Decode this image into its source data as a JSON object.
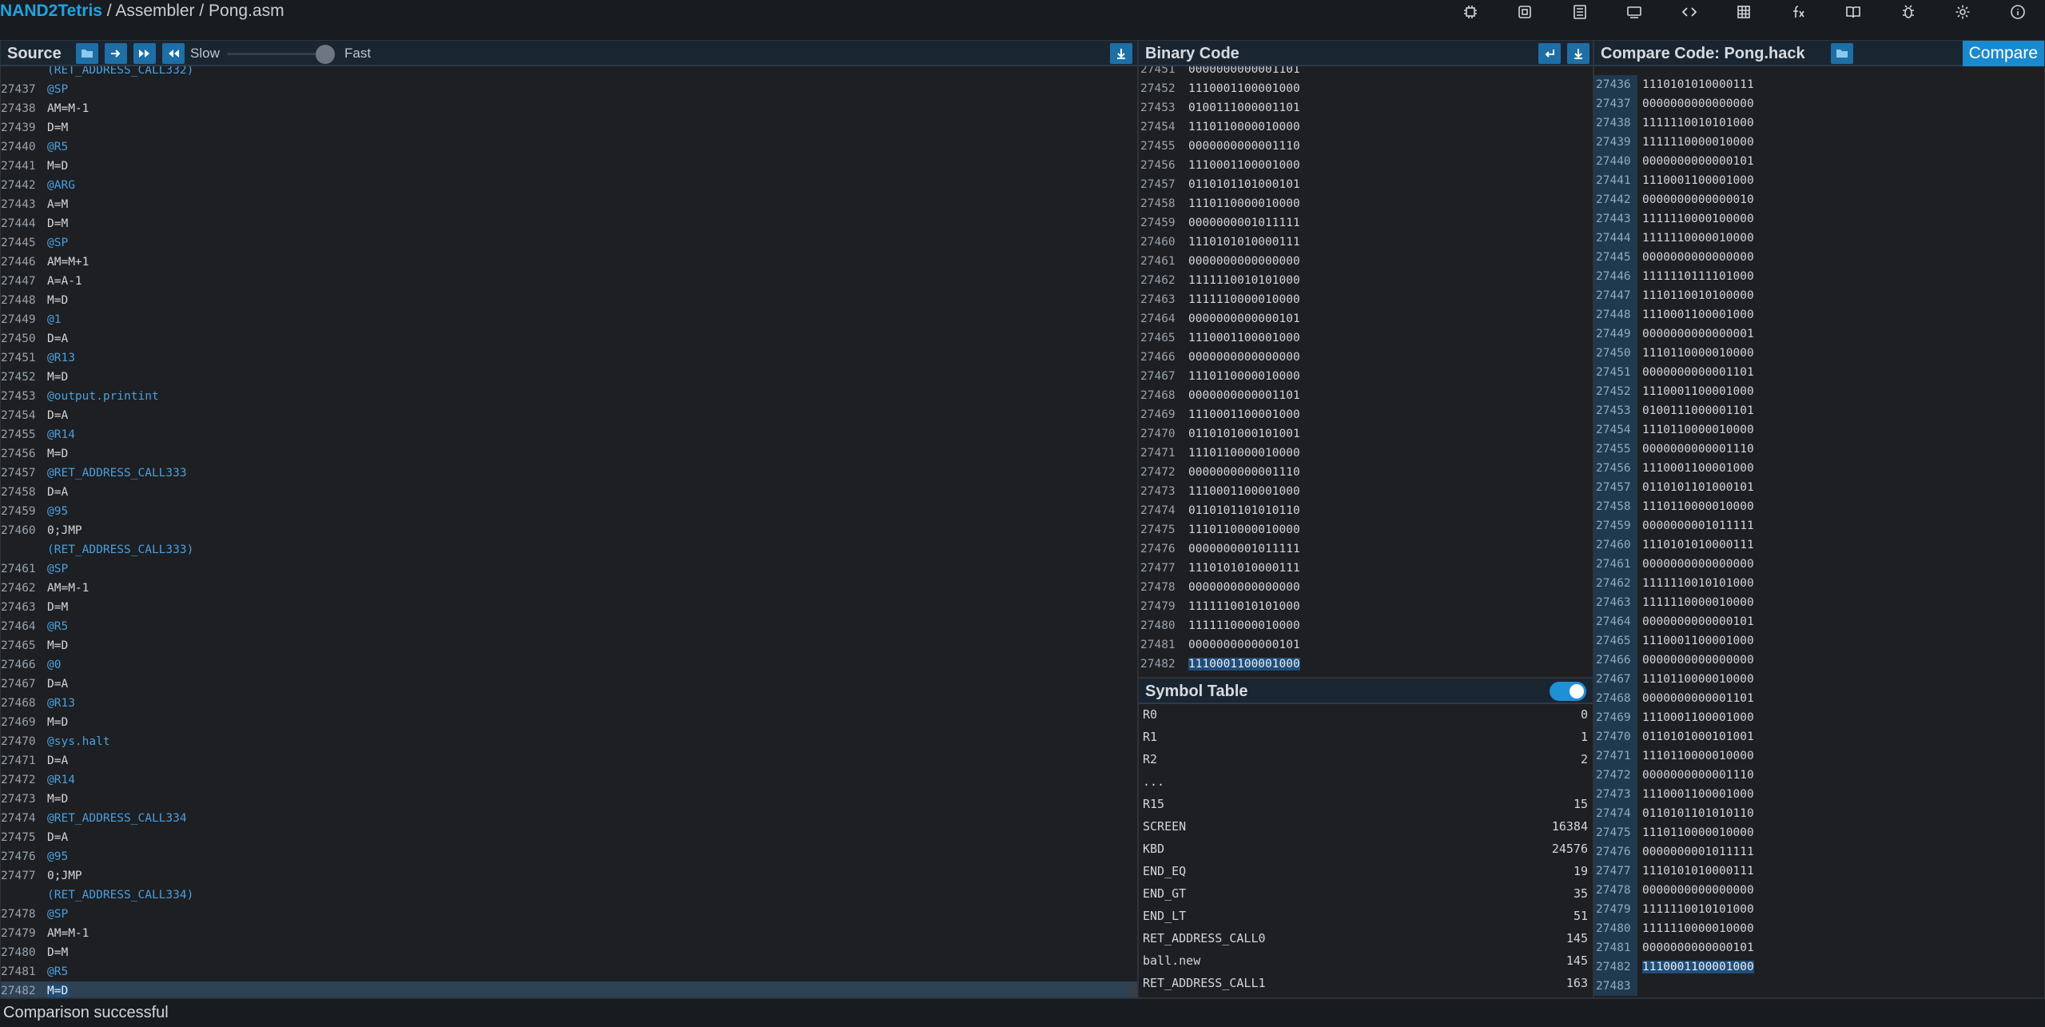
{
  "header": {
    "app": "NAND2Tetris",
    "sep1": " / ",
    "section": "Assembler",
    "sep2": " / ",
    "file": "Pong.asm",
    "icons": [
      "chip-icon",
      "cpu-icon",
      "asm-icon",
      "vm-icon",
      "compiler-icon",
      "bitmap-icon",
      "fx-icon",
      "book-icon",
      "bug-icon",
      "gear-icon",
      "info-icon"
    ]
  },
  "source": {
    "title": "Source",
    "slow_label": "Slow",
    "fast_label": "Fast",
    "speed_value": 0.9,
    "partial_top": "(RET_ADDRESS_CALL332)",
    "lines": [
      {
        "n": "27437",
        "pre": "",
        "sym": "@SP",
        "code": ""
      },
      {
        "n": "27438",
        "code": "AM=M-1"
      },
      {
        "n": "27439",
        "code": "D=M"
      },
      {
        "n": "27440",
        "pre": "",
        "sym": "@R5",
        "code": ""
      },
      {
        "n": "27441",
        "code": "M=D"
      },
      {
        "n": "27442",
        "sym": "@ARG",
        "code": ""
      },
      {
        "n": "27443",
        "code": "A=M"
      },
      {
        "n": "27444",
        "code": "D=M"
      },
      {
        "n": "27445",
        "sym": "@SP",
        "code": ""
      },
      {
        "n": "27446",
        "code": "AM=M+1"
      },
      {
        "n": "27447",
        "code": "A=A-1"
      },
      {
        "n": "27448",
        "code": "M=D"
      },
      {
        "n": "27449",
        "sym": "@1",
        "code": ""
      },
      {
        "n": "27450",
        "code": "D=A"
      },
      {
        "n": "27451",
        "sym": "@R13",
        "code": ""
      },
      {
        "n": "27452",
        "code": "M=D"
      },
      {
        "n": "27453",
        "sym": "@output.printint",
        "code": ""
      },
      {
        "n": "27454",
        "code": "D=A"
      },
      {
        "n": "27455",
        "sym": "@R14",
        "code": ""
      },
      {
        "n": "27456",
        "code": "M=D"
      },
      {
        "n": "27457",
        "sym": "@RET_ADDRESS_CALL333",
        "code": ""
      },
      {
        "n": "27458",
        "code": "D=A"
      },
      {
        "n": "27459",
        "sym": "@95",
        "code": ""
      },
      {
        "n": "27460",
        "code": "0;JMP"
      },
      {
        "n": "",
        "label": "(RET_ADDRESS_CALL333)"
      },
      {
        "n": "27461",
        "sym": "@SP",
        "code": ""
      },
      {
        "n": "27462",
        "code": "AM=M-1"
      },
      {
        "n": "27463",
        "code": "D=M"
      },
      {
        "n": "27464",
        "sym": "@R5",
        "code": ""
      },
      {
        "n": "27465",
        "code": "M=D"
      },
      {
        "n": "27466",
        "sym": "@0",
        "code": ""
      },
      {
        "n": "27467",
        "code": "D=A"
      },
      {
        "n": "27468",
        "sym": "@R13",
        "code": ""
      },
      {
        "n": "27469",
        "code": "M=D"
      },
      {
        "n": "27470",
        "sym": "@sys.halt",
        "code": ""
      },
      {
        "n": "27471",
        "code": "D=A"
      },
      {
        "n": "27472",
        "sym": "@R14",
        "code": ""
      },
      {
        "n": "27473",
        "code": "M=D"
      },
      {
        "n": "27474",
        "sym": "@RET_ADDRESS_CALL334",
        "code": ""
      },
      {
        "n": "27475",
        "code": "D=A"
      },
      {
        "n": "27476",
        "sym": "@95",
        "code": ""
      },
      {
        "n": "27477",
        "code": "0;JMP"
      },
      {
        "n": "",
        "label": "(RET_ADDRESS_CALL334)"
      },
      {
        "n": "27478",
        "sym": "@SP",
        "code": ""
      },
      {
        "n": "27479",
        "code": "AM=M-1"
      },
      {
        "n": "27480",
        "code": "D=M"
      },
      {
        "n": "27481",
        "sym": "@R5",
        "code": ""
      },
      {
        "n": "27482",
        "code": "M=D",
        "highlight": true
      }
    ]
  },
  "binary": {
    "title": "Binary Code",
    "lines": [
      {
        "n": "27451",
        "v": "0000000000001101"
      },
      {
        "n": "27452",
        "v": "1110001100001000"
      },
      {
        "n": "27453",
        "v": "0100111000001101"
      },
      {
        "n": "27454",
        "v": "1110110000010000"
      },
      {
        "n": "27455",
        "v": "0000000000001110"
      },
      {
        "n": "27456",
        "v": "1110001100001000"
      },
      {
        "n": "27457",
        "v": "0110101101000101"
      },
      {
        "n": "27458",
        "v": "1110110000010000"
      },
      {
        "n": "27459",
        "v": "0000000001011111"
      },
      {
        "n": "27460",
        "v": "1110101010000111"
      },
      {
        "n": "27461",
        "v": "0000000000000000"
      },
      {
        "n": "27462",
        "v": "1111110010101000"
      },
      {
        "n": "27463",
        "v": "1111110000010000"
      },
      {
        "n": "27464",
        "v": "0000000000000101"
      },
      {
        "n": "27465",
        "v": "1110001100001000"
      },
      {
        "n": "27466",
        "v": "0000000000000000"
      },
      {
        "n": "27467",
        "v": "1110110000010000"
      },
      {
        "n": "27468",
        "v": "0000000000001101"
      },
      {
        "n": "27469",
        "v": "1110001100001000"
      },
      {
        "n": "27470",
        "v": "0110101000101001"
      },
      {
        "n": "27471",
        "v": "1110110000010000"
      },
      {
        "n": "27472",
        "v": "0000000000001110"
      },
      {
        "n": "27473",
        "v": "1110001100001000"
      },
      {
        "n": "27474",
        "v": "0110101101010110"
      },
      {
        "n": "27475",
        "v": "1110110000010000"
      },
      {
        "n": "27476",
        "v": "0000000001011111"
      },
      {
        "n": "27477",
        "v": "1110101010000111"
      },
      {
        "n": "27478",
        "v": "0000000000000000"
      },
      {
        "n": "27479",
        "v": "1111110010101000"
      },
      {
        "n": "27480",
        "v": "1111110000010000"
      },
      {
        "n": "27481",
        "v": "0000000000000101"
      },
      {
        "n": "27482",
        "v": "1110001100001000",
        "highlight": true
      }
    ]
  },
  "symbols": {
    "title": "Symbol Table",
    "toggle_on": true,
    "rows": [
      {
        "name": "R0",
        "value": "0"
      },
      {
        "name": "R1",
        "value": "1"
      },
      {
        "name": "R2",
        "value": "2"
      },
      {
        "name": "...",
        "value": ""
      },
      {
        "name": "R15",
        "value": "15"
      },
      {
        "name": "SCREEN",
        "value": "16384"
      },
      {
        "name": "KBD",
        "value": "24576"
      },
      {
        "name": "END_EQ",
        "value": "19"
      },
      {
        "name": "END_GT",
        "value": "35"
      },
      {
        "name": "END_LT",
        "value": "51"
      },
      {
        "name": "RET_ADDRESS_CALL0",
        "value": "145"
      },
      {
        "name": "ball.new",
        "value": "145"
      },
      {
        "name": "RET_ADDRESS_CALL1",
        "value": "163"
      }
    ]
  },
  "compare": {
    "title": "Compare Code: Pong.hack",
    "button": "Compare",
    "lines": [
      {
        "n": "27436",
        "v": "1110101010000111"
      },
      {
        "n": "27437",
        "v": "0000000000000000"
      },
      {
        "n": "27438",
        "v": "1111110010101000"
      },
      {
        "n": "27439",
        "v": "1111110000010000"
      },
      {
        "n": "27440",
        "v": "0000000000000101"
      },
      {
        "n": "27441",
        "v": "1110001100001000"
      },
      {
        "n": "27442",
        "v": "0000000000000010"
      },
      {
        "n": "27443",
        "v": "1111110000100000"
      },
      {
        "n": "27444",
        "v": "1111110000010000"
      },
      {
        "n": "27445",
        "v": "0000000000000000"
      },
      {
        "n": "27446",
        "v": "1111110111101000"
      },
      {
        "n": "27447",
        "v": "1110110010100000"
      },
      {
        "n": "27448",
        "v": "1110001100001000"
      },
      {
        "n": "27449",
        "v": "0000000000000001"
      },
      {
        "n": "27450",
        "v": "1110110000010000"
      },
      {
        "n": "27451",
        "v": "0000000000001101"
      },
      {
        "n": "27452",
        "v": "1110001100001000"
      },
      {
        "n": "27453",
        "v": "0100111000001101"
      },
      {
        "n": "27454",
        "v": "1110110000010000"
      },
      {
        "n": "27455",
        "v": "0000000000001110"
      },
      {
        "n": "27456",
        "v": "1110001100001000"
      },
      {
        "n": "27457",
        "v": "0110101101000101"
      },
      {
        "n": "27458",
        "v": "1110110000010000"
      },
      {
        "n": "27459",
        "v": "0000000001011111"
      },
      {
        "n": "27460",
        "v": "1110101010000111"
      },
      {
        "n": "27461",
        "v": "0000000000000000"
      },
      {
        "n": "27462",
        "v": "1111110010101000"
      },
      {
        "n": "27463",
        "v": "1111110000010000"
      },
      {
        "n": "27464",
        "v": "0000000000000101"
      },
      {
        "n": "27465",
        "v": "1110001100001000"
      },
      {
        "n": "27466",
        "v": "0000000000000000"
      },
      {
        "n": "27467",
        "v": "1110110000010000"
      },
      {
        "n": "27468",
        "v": "0000000000001101"
      },
      {
        "n": "27469",
        "v": "1110001100001000"
      },
      {
        "n": "27470",
        "v": "0110101000101001"
      },
      {
        "n": "27471",
        "v": "1110110000010000"
      },
      {
        "n": "27472",
        "v": "0000000000001110"
      },
      {
        "n": "27473",
        "v": "1110001100001000"
      },
      {
        "n": "27474",
        "v": "0110101101010110"
      },
      {
        "n": "27475",
        "v": "1110110000010000"
      },
      {
        "n": "27476",
        "v": "0000000001011111"
      },
      {
        "n": "27477",
        "v": "1110101010000111"
      },
      {
        "n": "27478",
        "v": "0000000000000000"
      },
      {
        "n": "27479",
        "v": "1111110010101000"
      },
      {
        "n": "27480",
        "v": "1111110000010000"
      },
      {
        "n": "27481",
        "v": "0000000000000101"
      },
      {
        "n": "27482",
        "v": "1110001100001000",
        "highlight": true
      },
      {
        "n": "27483",
        "v": ""
      }
    ]
  },
  "status": {
    "text": "Comparison successful"
  }
}
